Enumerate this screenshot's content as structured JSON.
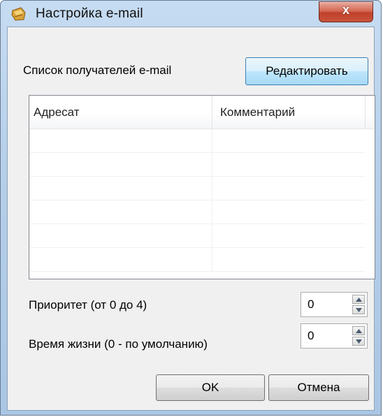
{
  "window": {
    "title": "Настройка e-mail",
    "close_label": "x"
  },
  "recipients": {
    "label": "Список получателей e-mail",
    "edit_button": "Редактировать",
    "columns": [
      "Адресат",
      "Комментарий"
    ],
    "rows": [
      [
        "",
        ""
      ],
      [
        "",
        ""
      ],
      [
        "",
        ""
      ],
      [
        "",
        ""
      ],
      [
        "",
        ""
      ],
      [
        "",
        ""
      ]
    ]
  },
  "priority": {
    "label": "Приоритет (от 0 до 4)",
    "value": "0"
  },
  "lifetime": {
    "label": "Время жизни (0 - по умолчанию)",
    "value": "0"
  },
  "buttons": {
    "ok": "OK",
    "cancel": "Отмена"
  }
}
